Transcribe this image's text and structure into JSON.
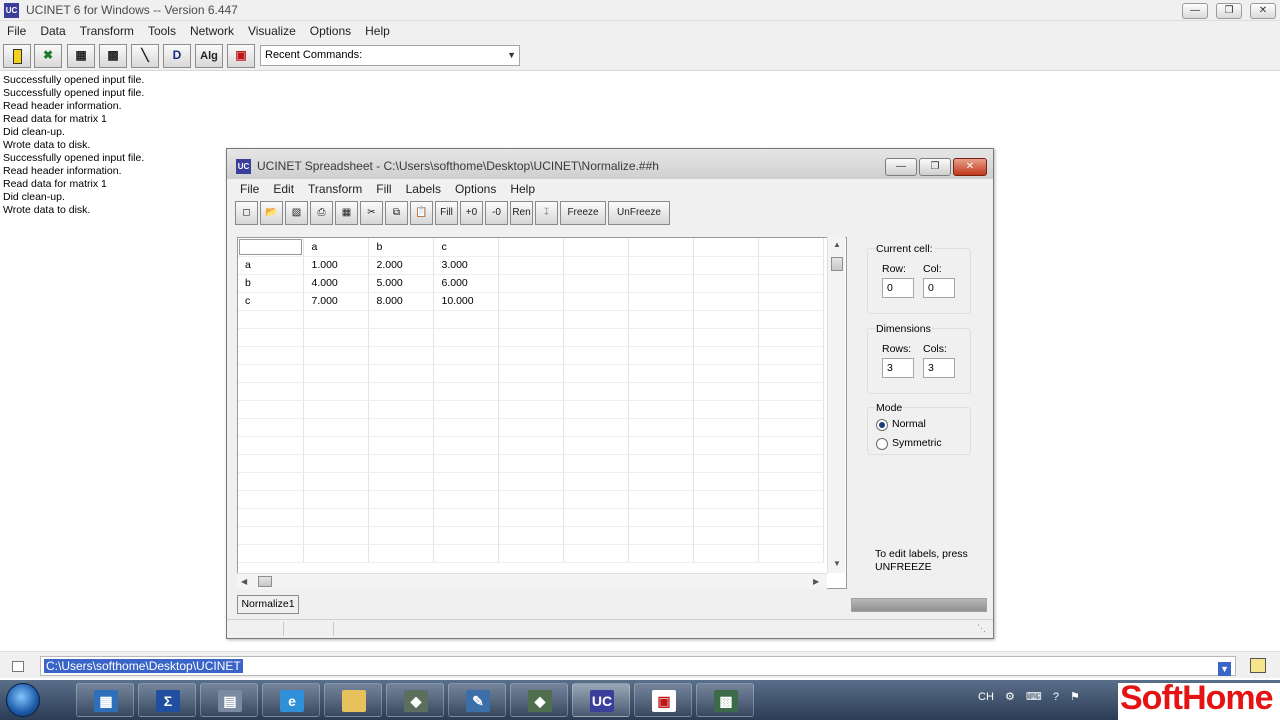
{
  "app": {
    "title": "UCINET 6 for Windows -- Version 6.447",
    "menu": [
      "File",
      "Data",
      "Transform",
      "Tools",
      "Network",
      "Visualize",
      "Options",
      "Help"
    ],
    "recent_commands_label": "Recent Commands:",
    "toolbar": {
      "d_label": "D",
      "alg_label": "Alg"
    },
    "log": [
      "Successfully opened input file.",
      "Successfully opened input file.",
      "Read header information.",
      "Read data for matrix 1",
      "Did clean-up.",
      "Wrote data to disk.",
      "Successfully opened input file.",
      "Read header information.",
      "Read data for matrix 1",
      "Did clean-up.",
      "Wrote data to disk."
    ],
    "command_path": "C:\\Users\\softhome\\Desktop\\UCINET"
  },
  "spreadsheet": {
    "title": "UCINET Spreadsheet - C:\\Users\\softhome\\Desktop\\UCINET\\Normalize.##h",
    "menu": [
      "File",
      "Edit",
      "Transform",
      "Fill",
      "Labels",
      "Options",
      "Help"
    ],
    "toolbar": {
      "fill": "Fill",
      "plus0": "+0",
      "minus0": "-0",
      "ren": "Ren",
      "freeze": "Freeze",
      "unfreeze": "UnFreeze"
    },
    "columns": [
      "a",
      "b",
      "c"
    ],
    "rows": [
      {
        "label": "a",
        "values": [
          "1.000",
          "2.000",
          "3.000"
        ]
      },
      {
        "label": "b",
        "values": [
          "4.000",
          "5.000",
          "6.000"
        ]
      },
      {
        "label": "c",
        "values": [
          "7.000",
          "8.000",
          "10.000"
        ]
      }
    ],
    "sheet_tab": "Normalize1",
    "current_cell": {
      "title": "Current cell:",
      "row_label": "Row:",
      "col_label": "Col:",
      "row": "0",
      "col": "0"
    },
    "dimensions": {
      "title": "Dimensions",
      "rows_label": "Rows:",
      "cols_label": "Cols:",
      "rows": "3",
      "cols": "3"
    },
    "mode": {
      "title": "Mode",
      "options": [
        "Normal",
        "Symmetric"
      ],
      "selected": "Normal"
    },
    "edit_hint": "To edit labels, press UNFREEZE"
  },
  "taskbar": {
    "tray_lang": "CH",
    "logo_text": "SoftHome"
  }
}
